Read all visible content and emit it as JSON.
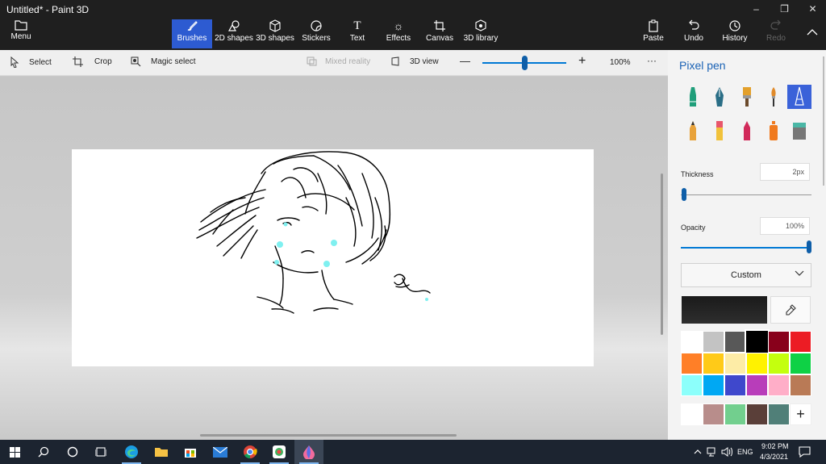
{
  "window": {
    "title": "Untitled* - Paint 3D",
    "minimize": "–",
    "maximize": "❐",
    "close": "✕"
  },
  "toolbar": {
    "menu_label": "Menu",
    "items": [
      {
        "label": "Brushes",
        "icon": "brush-icon"
      },
      {
        "label": "2D shapes",
        "icon": "2d-shapes-icon"
      },
      {
        "label": "3D shapes",
        "icon": "3d-shapes-icon"
      },
      {
        "label": "Stickers",
        "icon": "stickers-icon"
      },
      {
        "label": "Text",
        "icon": "text-icon"
      },
      {
        "label": "Effects",
        "icon": "effects-icon"
      },
      {
        "label": "Canvas",
        "icon": "canvas-icon"
      },
      {
        "label": "3D library",
        "icon": "3d-library-icon"
      }
    ],
    "right_items": [
      {
        "label": "Paste",
        "icon": "paste-icon"
      },
      {
        "label": "Undo",
        "icon": "undo-icon"
      },
      {
        "label": "History",
        "icon": "history-icon"
      },
      {
        "label": "Redo",
        "icon": "redo-icon"
      }
    ]
  },
  "subbar": {
    "select": "Select",
    "crop": "Crop",
    "magic_select": "Magic select",
    "mixed_reality": "Mixed reality",
    "view_3d": "3D view",
    "zoom_minus": "—",
    "zoom_plus": "+",
    "zoom": "100%",
    "more": "···"
  },
  "panel": {
    "title": "Pixel pen",
    "brushes": [
      {
        "name": "Marker",
        "icon": "marker-icon",
        "color": "#1f9e7a"
      },
      {
        "name": "Calligraphy pen",
        "icon": "calligraphy-pen-icon",
        "color": "#2a6e86"
      },
      {
        "name": "Oil brush",
        "icon": "oil-brush-icon",
        "color": "#e3a02b"
      },
      {
        "name": "Watercolor",
        "icon": "watercolor-icon",
        "color": "#e08a2a"
      },
      {
        "name": "Pixel pen",
        "icon": "pixel-pen-icon",
        "color": "#ffffff"
      },
      {
        "name": "Pencil",
        "icon": "pencil-icon",
        "color": "#e8a23a"
      },
      {
        "name": "Eraser",
        "icon": "eraser-icon",
        "color": "#e8566b"
      },
      {
        "name": "Crayon",
        "icon": "crayon-icon",
        "color": "#d12a5a"
      },
      {
        "name": "Spray can",
        "icon": "spray-can-icon",
        "color": "#f07a1e"
      },
      {
        "name": "Fill",
        "icon": "fill-bucket-icon",
        "color": "#4ab7a6"
      }
    ],
    "thickness_label": "Thickness",
    "thickness_value": "2px",
    "thickness_level": 0.02,
    "opacity_label": "Opacity",
    "opacity_value": "100%",
    "opacity_level": 1.0,
    "color_mode": "Custom",
    "current_color": "#1e1e1e",
    "palette": [
      "#ffffff",
      "#c3c3c3",
      "#585858",
      "#000000",
      "#88001b",
      "#ec1c24",
      "#ff7f27",
      "#ffca18",
      "#fdeca6",
      "#fff200",
      "#c4ff0e",
      "#0ed145",
      "#8cfffb",
      "#00a8f3",
      "#3f48cc",
      "#b83dba",
      "#ffaec8",
      "#b97a56"
    ],
    "custom_colors": [
      "#ffffff",
      "#b88d8b",
      "#72cf8e",
      "#5a3f39",
      "#507f78"
    ],
    "add_label": "+"
  },
  "taskbar": {
    "apps": [
      {
        "name": "start",
        "icon": "windows-start-icon"
      },
      {
        "name": "search",
        "icon": "search-icon"
      },
      {
        "name": "cortana",
        "icon": "cortana-icon"
      },
      {
        "name": "task-view",
        "icon": "task-view-icon"
      },
      {
        "name": "edge",
        "icon": "edge-icon"
      },
      {
        "name": "file-explorer",
        "icon": "file-explorer-icon"
      },
      {
        "name": "store",
        "icon": "store-icon"
      },
      {
        "name": "mail",
        "icon": "mail-icon"
      },
      {
        "name": "chrome",
        "icon": "chrome-icon"
      },
      {
        "name": "photos",
        "icon": "photos-icon"
      },
      {
        "name": "paint-3d",
        "icon": "paint-3d-icon"
      }
    ],
    "language": "ENG",
    "time": "9:02 PM",
    "date": "4/3/2021"
  }
}
